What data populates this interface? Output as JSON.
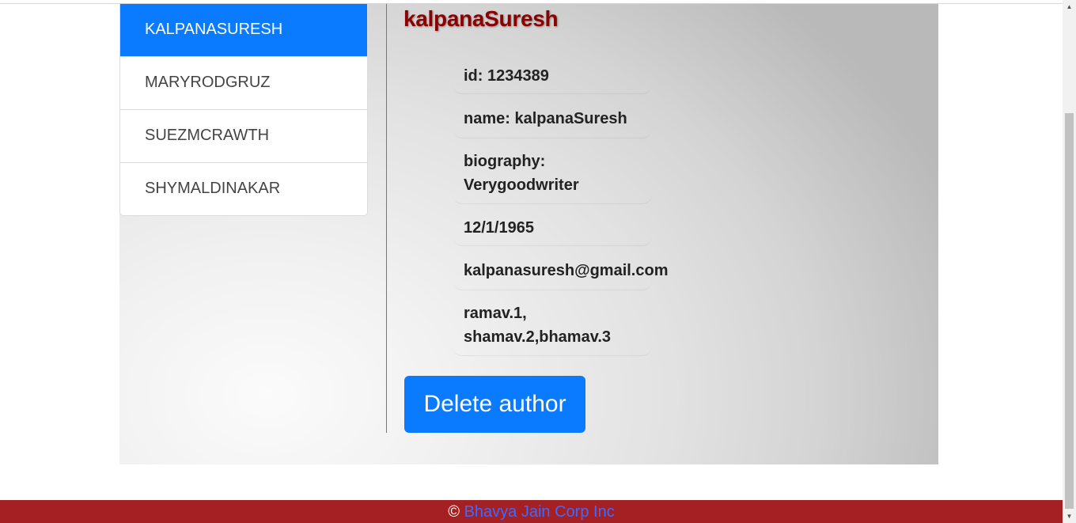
{
  "authors": [
    {
      "label": "KALPANASURESH",
      "active": true
    },
    {
      "label": "MARYRODGRUZ",
      "active": false
    },
    {
      "label": "SUEZMCRAWTH",
      "active": false
    },
    {
      "label": "SHYMALDINAKAR",
      "active": false
    }
  ],
  "selected_author": {
    "title": "kalpanaSuresh",
    "id_line": "id: 1234389",
    "name_line": "name: kalpanaSuresh",
    "biography_line1": "biography:",
    "biography_line2": "Verygoodwriter",
    "dob": "12/1/1965",
    "email": "kalpanasuresh@gmail.com",
    "books_line1": "ramav.1,",
    "books_line2": "shamav.2,bhamav.3"
  },
  "actions": {
    "delete_label": "Delete author"
  },
  "footer": {
    "copyright_symbol": "©",
    "link_text": "Bhavya Jain Corp Inc"
  },
  "colors": {
    "accent": "#0a7bff",
    "title": "#8b0000",
    "footer_bg": "#a52022",
    "footer_link": "#3d6bff"
  }
}
